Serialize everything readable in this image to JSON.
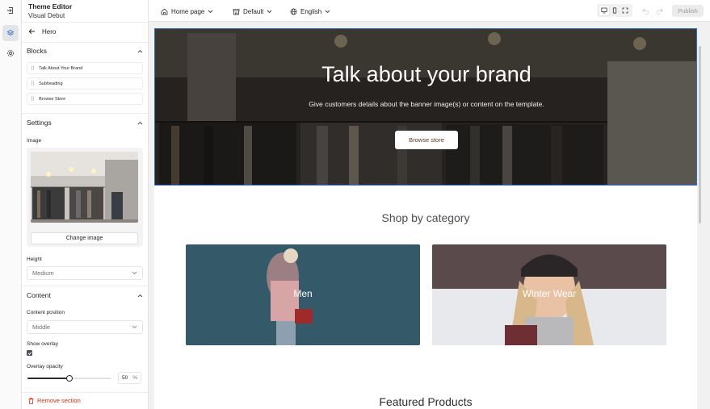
{
  "app": {
    "title": "Theme Editor",
    "subtitle": "Visual Debut"
  },
  "rail": {
    "icons": [
      "exit-icon",
      "layers-icon",
      "gear-icon"
    ]
  },
  "sidebar": {
    "back_label": "Hero",
    "blocks": {
      "heading": "Blocks",
      "items": [
        {
          "label": "Talk About Your Brand"
        },
        {
          "label": "Subheading"
        },
        {
          "label": "Browse Store"
        }
      ]
    },
    "settings": {
      "heading": "Settings",
      "image_label": "Image",
      "change_image": "Change image",
      "height_label": "Height",
      "height_value": "Medium"
    },
    "content": {
      "heading": "Content",
      "position_label": "Content position",
      "position_value": "Middle",
      "overlay_label": "Show overlay",
      "overlay_checked": true,
      "opacity_label": "Overlay opacity",
      "opacity_value": "50",
      "opacity_unit": "%",
      "opacity_fraction": 0.5
    },
    "remove_label": "Remove section"
  },
  "topbar": {
    "page": "Home page",
    "template": "Default",
    "language": "English",
    "publish": "Publish",
    "active_device": "desktop"
  },
  "preview": {
    "hero": {
      "title": "Talk about your brand",
      "text": "Give customers details about the banner image(s) or content on the template.",
      "button": "Browse store"
    },
    "shop_title": "Shop by category",
    "categories": [
      {
        "label": "Men"
      },
      {
        "label": "Winter Wear"
      }
    ],
    "featured_title": "Featured Products"
  },
  "colors": {
    "accent": "#2c6ecb",
    "danger": "#d72c0d"
  }
}
